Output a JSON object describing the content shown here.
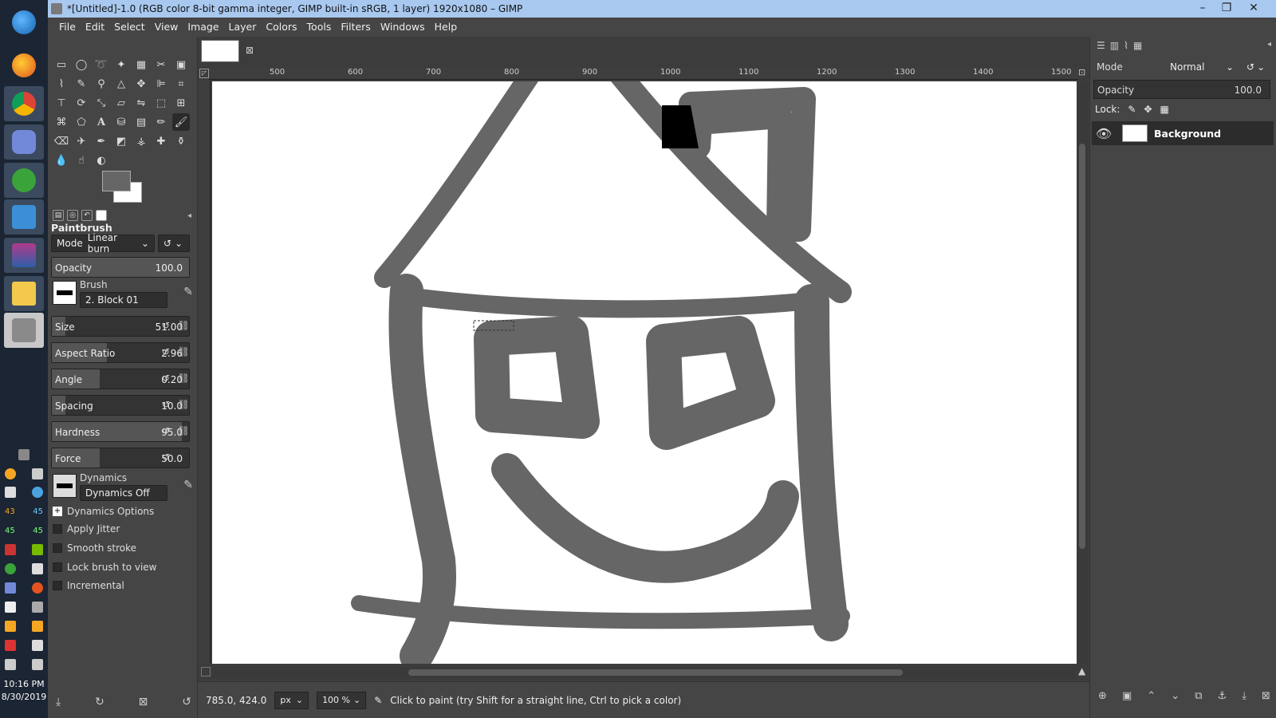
{
  "window": {
    "title": "*[Untitled]-1.0 (RGB color 8-bit gamma integer, GIMP built-in sRGB, 1 layer) 1920x1080 – GIMP",
    "min": "–",
    "max": "❐",
    "close": "✕"
  },
  "menubar": [
    "File",
    "Edit",
    "Select",
    "View",
    "Image",
    "Layer",
    "Colors",
    "Tools",
    "Filters",
    "Windows",
    "Help"
  ],
  "taskbar": {
    "clock_time": "10:16 PM",
    "clock_date": "8/30/2019",
    "tray_nums": [
      "43",
      "45",
      "45",
      "45"
    ]
  },
  "tool_options": {
    "title": "Paintbrush",
    "mode_label": "Mode",
    "mode_value": "Linear burn",
    "opacity_label": "Opacity",
    "opacity_value": "100.0",
    "brush_label": "Brush",
    "brush_value": "2. Block 01",
    "size_label": "Size",
    "size_value": "51.00",
    "aspect_label": "Aspect Ratio",
    "aspect_value": "2.96",
    "angle_label": "Angle",
    "angle_value": "0.20",
    "spacing_label": "Spacing",
    "spacing_value": "10.0",
    "hardness_label": "Hardness",
    "hardness_value": "95.0",
    "force_label": "Force",
    "force_value": "50.0",
    "dynamics_label": "Dynamics",
    "dynamics_value": "Dynamics Off",
    "dynamics_options": "Dynamics Options",
    "apply_jitter": "Apply Jitter",
    "smooth_stroke": "Smooth stroke",
    "lock_brush": "Lock brush to view",
    "incremental": "Incremental"
  },
  "ruler_labels": [
    "500",
    "600",
    "700",
    "800",
    "900",
    "1000",
    "1100",
    "1200",
    "1300",
    "1400",
    "1500"
  ],
  "status": {
    "coords": "785.0, 424.0",
    "unit": "px",
    "zoom": "100 %",
    "message": "Click to paint (try Shift for a straight line, Ctrl to pick a color)"
  },
  "layers": {
    "mode_label": "Mode",
    "mode_value": "Normal",
    "opacity_label": "Opacity",
    "opacity_value": "100.0",
    "lock_label": "Lock:",
    "layer_name": "Background"
  },
  "colors": {
    "stroke": "#666666",
    "fg": "#666666",
    "bg": "#ffffff"
  }
}
